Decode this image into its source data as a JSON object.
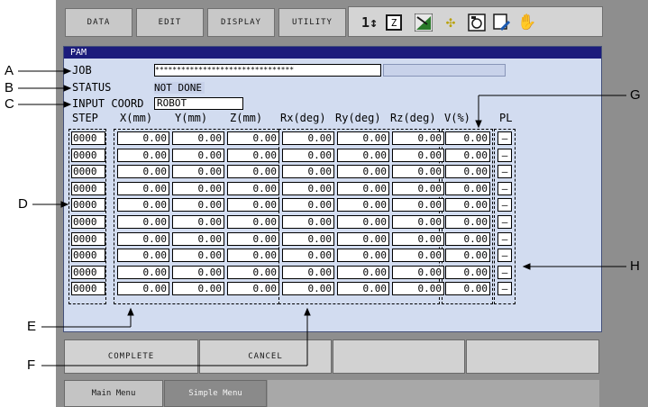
{
  "menu": [
    "DATA",
    "EDIT",
    "DISPLAY",
    "UTILITY"
  ],
  "icons": [
    "interlock-icon",
    "note-icon",
    "signal-icon",
    "tool-icon",
    "camera-icon",
    "edit-icon",
    "hand-icon"
  ],
  "screen": {
    "title": "PAM",
    "job_label": "JOB",
    "job_value": "********************************",
    "status_label": "STATUS",
    "status_value": "NOT DONE",
    "coord_label": "INPUT COORD",
    "coord_value": "ROBOT"
  },
  "table": {
    "headers": [
      "STEP",
      "X(mm)",
      "Y(mm)",
      "Z(mm)",
      "Rx(deg)",
      "Ry(deg)",
      "Rz(deg)",
      "V(%)",
      "PL"
    ],
    "rows": [
      [
        "0000",
        "0.00",
        "0.00",
        "0.00",
        "0.00",
        "0.00",
        "0.00",
        "0.00",
        "–"
      ],
      [
        "0000",
        "0.00",
        "0.00",
        "0.00",
        "0.00",
        "0.00",
        "0.00",
        "0.00",
        "–"
      ],
      [
        "0000",
        "0.00",
        "0.00",
        "0.00",
        "0.00",
        "0.00",
        "0.00",
        "0.00",
        "–"
      ],
      [
        "0000",
        "0.00",
        "0.00",
        "0.00",
        "0.00",
        "0.00",
        "0.00",
        "0.00",
        "–"
      ],
      [
        "0000",
        "0.00",
        "0.00",
        "0.00",
        "0.00",
        "0.00",
        "0.00",
        "0.00",
        "–"
      ],
      [
        "0000",
        "0.00",
        "0.00",
        "0.00",
        "0.00",
        "0.00",
        "0.00",
        "0.00",
        "–"
      ],
      [
        "0000",
        "0.00",
        "0.00",
        "0.00",
        "0.00",
        "0.00",
        "0.00",
        "0.00",
        "–"
      ],
      [
        "0000",
        "0.00",
        "0.00",
        "0.00",
        "0.00",
        "0.00",
        "0.00",
        "0.00",
        "–"
      ],
      [
        "0000",
        "0.00",
        "0.00",
        "0.00",
        "0.00",
        "0.00",
        "0.00",
        "0.00",
        "–"
      ],
      [
        "0000",
        "0.00",
        "0.00",
        "0.00",
        "0.00",
        "0.00",
        "0.00",
        "0.00",
        "–"
      ]
    ]
  },
  "buttons": {
    "complete": "COMPLETE",
    "cancel": "CANCEL"
  },
  "tabs": {
    "main": "Main Menu",
    "simple": "Simple Menu"
  },
  "callouts": [
    "A",
    "B",
    "C",
    "D",
    "E",
    "F",
    "G",
    "H"
  ]
}
